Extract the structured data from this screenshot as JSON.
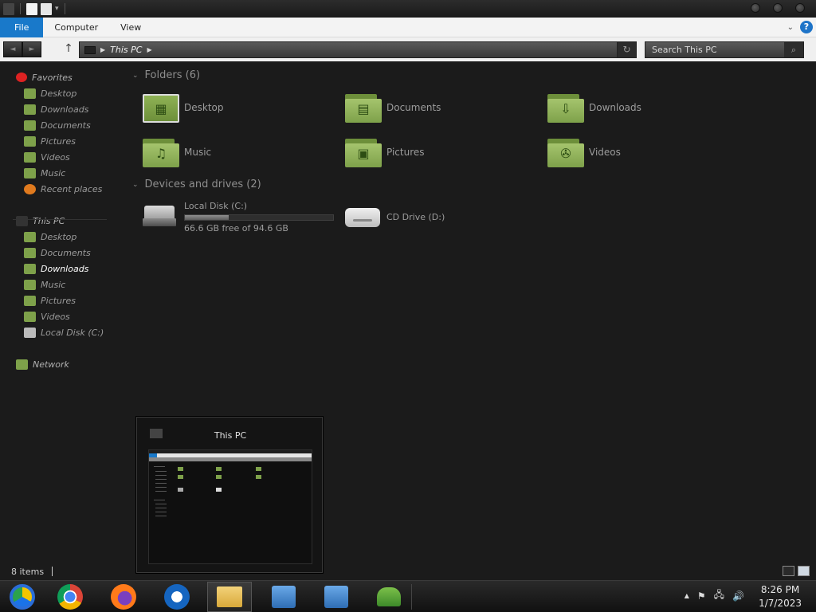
{
  "window": {
    "qat_icons": [
      "monitor-icon",
      "properties-icon",
      "new-folder-icon"
    ],
    "controls": [
      "minimize-button",
      "maximize-button",
      "close-button"
    ]
  },
  "ribbon": {
    "tabs": [
      {
        "label": "File"
      },
      {
        "label": "Computer"
      },
      {
        "label": "View"
      }
    ],
    "help": "?"
  },
  "addressbar": {
    "back": "◄",
    "forward": "►",
    "up": "↑",
    "crumb": "This PC",
    "refresh": "↻",
    "search_placeholder": "Search This PC",
    "search_icon": "⌕"
  },
  "sidebar": {
    "favorites": {
      "label": "Favorites",
      "items": [
        {
          "label": "Desktop"
        },
        {
          "label": "Downloads"
        },
        {
          "label": "Documents"
        },
        {
          "label": "Pictures"
        },
        {
          "label": "Videos"
        },
        {
          "label": "Music"
        },
        {
          "label": "Recent places"
        }
      ]
    },
    "thispc": {
      "label": "This PC",
      "items": [
        {
          "label": "Desktop"
        },
        {
          "label": "Documents"
        },
        {
          "label": "Downloads"
        },
        {
          "label": "Music"
        },
        {
          "label": "Pictures"
        },
        {
          "label": "Videos"
        },
        {
          "label": "Local Disk (C:)"
        }
      ]
    },
    "network": {
      "label": "Network"
    }
  },
  "content": {
    "folders_header": "Folders (6)",
    "folders": [
      {
        "label": "Desktop",
        "glyph": "▦"
      },
      {
        "label": "Documents",
        "glyph": "▤"
      },
      {
        "label": "Downloads",
        "glyph": "⇩"
      },
      {
        "label": "Music",
        "glyph": "♫"
      },
      {
        "label": "Pictures",
        "glyph": "▣"
      },
      {
        "label": "Videos",
        "glyph": "✇"
      }
    ],
    "devices_header": "Devices and drives (2)",
    "drives": [
      {
        "label": "Local Disk (C:)",
        "free_text": "66.6 GB free of 94.6 GB",
        "used_fraction": 0.296
      },
      {
        "label": "CD Drive (D:)"
      }
    ]
  },
  "preview": {
    "title": "This PC"
  },
  "statusbar": {
    "count": "8 items"
  },
  "taskbar": {
    "apps": [
      "chromium-icon",
      "chrome-icon",
      "firefox-icon",
      "mail-icon",
      "file-explorer-icon",
      "network-setup-icon",
      "network-setup-icon-2",
      "users-icon"
    ],
    "tray_up": "▲",
    "tray_flag": "⚑",
    "tray_network": "🖧",
    "tray_volume": "🔊",
    "clock_time": "8:26 PM",
    "clock_date": "1/7/2023"
  },
  "colors": {
    "accent_blue": "#1979ca",
    "folder_green": "#7ea14a",
    "background": "#1b1b1b"
  }
}
